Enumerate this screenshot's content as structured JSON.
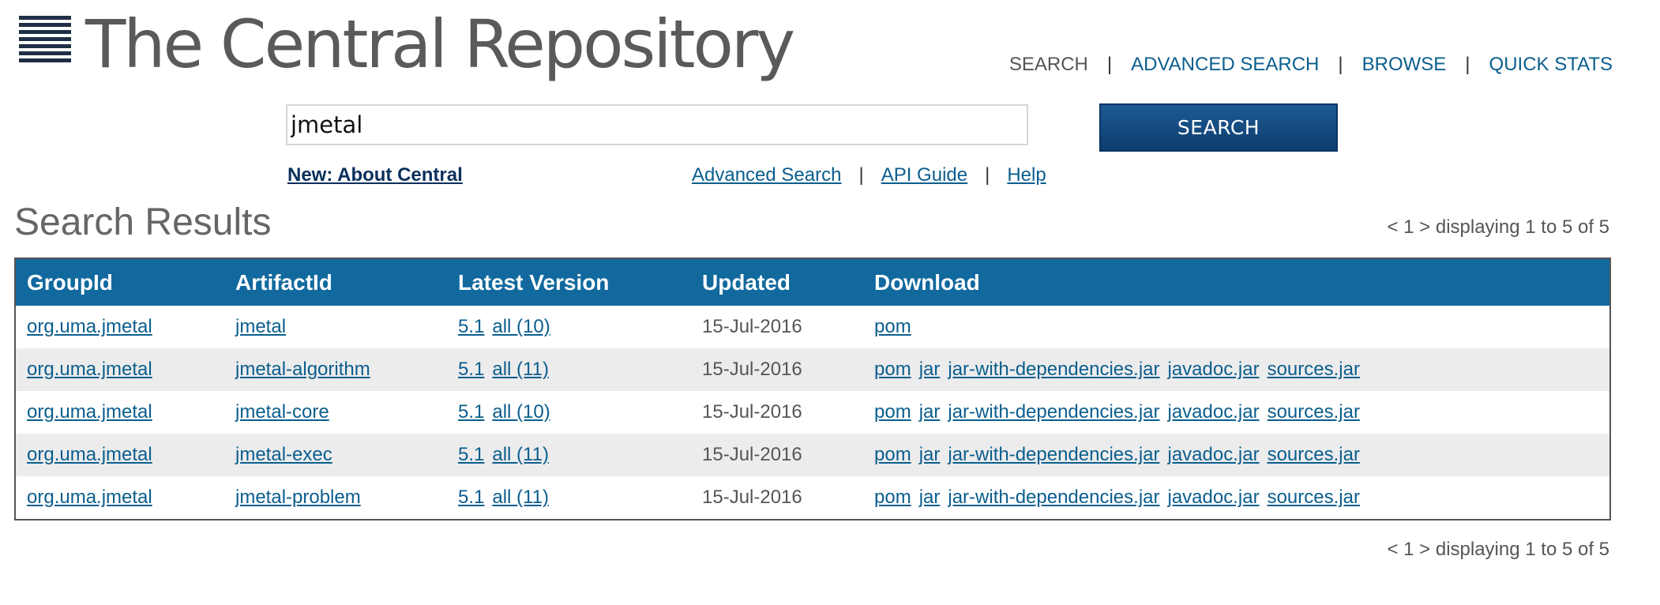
{
  "header": {
    "title": "The Central Repository",
    "nav": [
      {
        "label": "SEARCH",
        "current": true
      },
      {
        "label": "ADVANCED SEARCH",
        "current": false
      },
      {
        "label": "BROWSE",
        "current": false
      },
      {
        "label": "QUICK STATS",
        "current": false
      }
    ]
  },
  "search": {
    "value": "jmetal",
    "button_label": "SEARCH"
  },
  "links": {
    "about": "New: About Central",
    "advanced": "Advanced Search",
    "api": "API Guide",
    "help": "Help"
  },
  "results": {
    "title": "Search Results",
    "pager_text": "< 1 > displaying 1 to 5 of 5",
    "columns": [
      "GroupId",
      "ArtifactId",
      "Latest Version",
      "Updated",
      "Download"
    ],
    "rows": [
      {
        "group": "org.uma.jmetal",
        "artifact": "jmetal",
        "version": "5.1",
        "all": "all (10)",
        "updated": "15-Jul-2016",
        "downloads": [
          "pom"
        ]
      },
      {
        "group": "org.uma.jmetal",
        "artifact": "jmetal-algorithm",
        "version": "5.1",
        "all": "all (11)",
        "updated": "15-Jul-2016",
        "downloads": [
          "pom",
          "jar",
          "jar-with-dependencies.jar",
          "javadoc.jar",
          "sources.jar"
        ]
      },
      {
        "group": "org.uma.jmetal",
        "artifact": "jmetal-core",
        "version": "5.1",
        "all": "all (10)",
        "updated": "15-Jul-2016",
        "downloads": [
          "pom",
          "jar",
          "jar-with-dependencies.jar",
          "javadoc.jar",
          "sources.jar"
        ]
      },
      {
        "group": "org.uma.jmetal",
        "artifact": "jmetal-exec",
        "version": "5.1",
        "all": "all (11)",
        "updated": "15-Jul-2016",
        "downloads": [
          "pom",
          "jar",
          "jar-with-dependencies.jar",
          "javadoc.jar",
          "sources.jar"
        ]
      },
      {
        "group": "org.uma.jmetal",
        "artifact": "jmetal-problem",
        "version": "5.1",
        "all": "all (11)",
        "updated": "15-Jul-2016",
        "downloads": [
          "pom",
          "jar",
          "jar-with-dependencies.jar",
          "javadoc.jar",
          "sources.jar"
        ]
      }
    ]
  },
  "colors": {
    "header_bar": "#11699e",
    "link": "#0b5e8e",
    "button": "#0d3d6e",
    "row_alt": "#ececec"
  },
  "icons": {
    "logo": "stacked-lines-logo-icon"
  }
}
